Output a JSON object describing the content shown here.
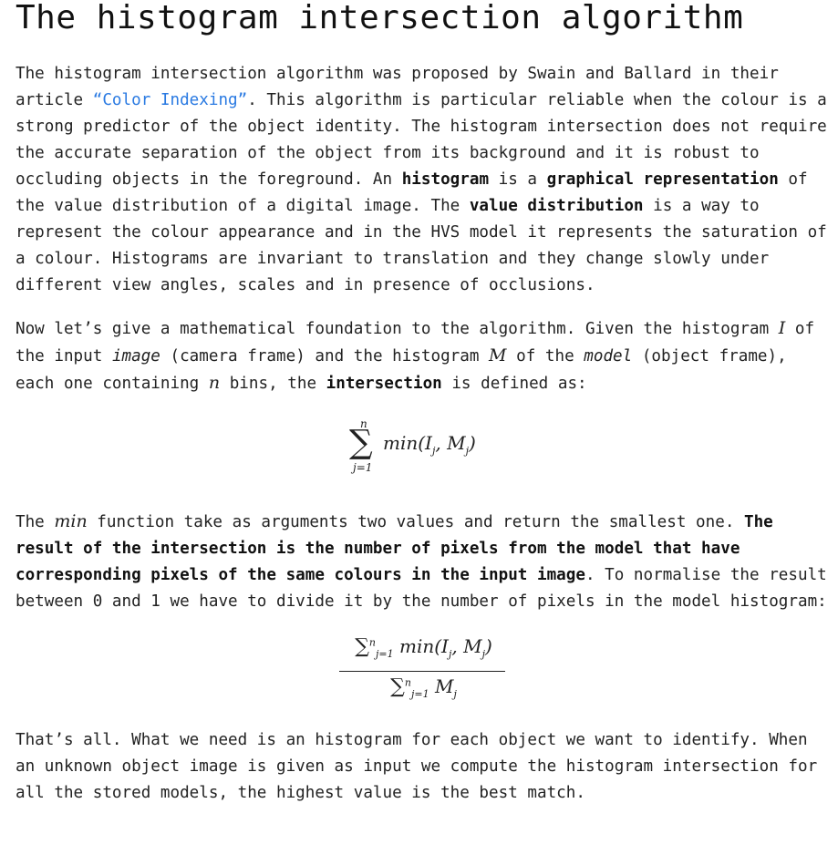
{
  "title": "The histogram intersection algorithm",
  "para1": {
    "t1": "The histogram intersection algorithm was proposed by Swain and Ballard in their article ",
    "link": "“Color Indexing”",
    "t2": ". This algorithm is particular reliable when the colour is a strong predictor of the object identity. The histogram intersection does not require the accurate separation of the object from its background and it is robust to occluding objects in the foreground. An ",
    "b1": "histogram",
    "t3": " is a ",
    "b2": "graphical representation",
    "t4": " of the value distribution of a digital image. The ",
    "b3": "value distribution",
    "t5": " is a way to represent the colour appearance and in the HVS model it represents the saturation of a colour. Histograms are invariant to translation and they change slowly under different view angles, scales and in presence of occlusions."
  },
  "para2": {
    "t1": "Now let’s give a mathematical foundation to the algorithm. Given the histogram ",
    "m1": "I",
    "t2": " of the input ",
    "i1": "image",
    "t3": " (camera frame) and the histogram ",
    "m2": "M",
    "t4": " of the ",
    "i2": "model",
    "t5": " (object frame), each one containing ",
    "m3": "n",
    "t6": " bins, the ",
    "b1": "intersection",
    "t7": " is defined as:"
  },
  "formula1": {
    "upper": "n",
    "sigma": "∑",
    "lower": "j=1",
    "body": "min(I",
    "sub1": "j",
    "mid": ", M",
    "sub2": "j",
    "end": ")"
  },
  "para3": {
    "t1": "The ",
    "m1": "min",
    "t2": " function take as arguments two values and return the smallest one. ",
    "b1": "The result of the intersection is the number of pixels from the model that have corresponding pixels of the same colours in the input image",
    "t3": ". To normalise the result between 0 and 1 we have to divide it by the number of pixels in the model histogram:"
  },
  "formula2": {
    "num_sigma": "∑",
    "num_sup": "n",
    "num_sub": "j=1",
    "num_body": "min(I",
    "num_s1": "j",
    "num_mid": ", M",
    "num_s2": "j",
    "num_end": ")",
    "den_sigma": "∑",
    "den_sup": "n",
    "den_sub": "j=1",
    "den_body": "M",
    "den_s": "j"
  },
  "para4": "That’s all. What we need is an histogram for each object we want to identify. When an unknown object image is given as input we compute the histogram intersection for all the stored models, the highest value is the best match."
}
